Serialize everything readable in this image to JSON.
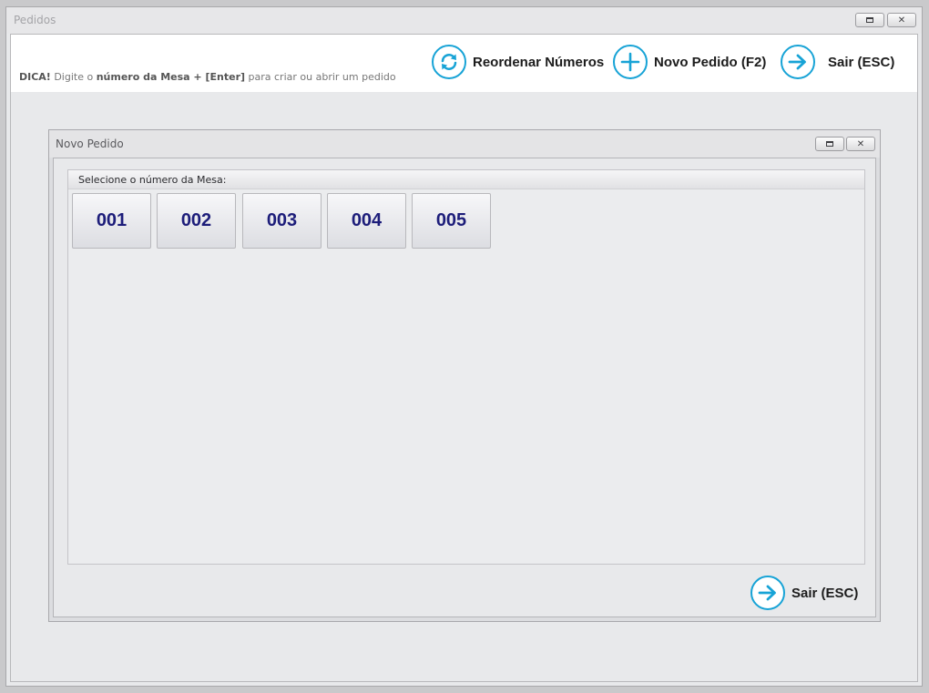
{
  "window": {
    "title": "Pedidos",
    "restore_glyph": "▫",
    "close_glyph": "✕"
  },
  "toolbar": {
    "hint_prefix": "DICA!",
    "hint_mid1": " Digite o ",
    "hint_bold1": "número da Mesa + [Enter]",
    "hint_suffix": " para criar ou abrir um pedido",
    "reorder_label": "Reordenar Números",
    "new_order_label": "Novo Pedido (F2)",
    "exit_label": "Sair (ESC)",
    "accent_color": "#17a3d6"
  },
  "dialog": {
    "title": "Novo Pedido",
    "group_label": "Selecione o número da Mesa:",
    "tables": [
      "001",
      "002",
      "003",
      "004",
      "005"
    ],
    "exit_label": "Sair (ESC)"
  },
  "icons": {
    "reorder": "refresh-icon",
    "new": "plus-icon",
    "exit": "arrow-right-icon"
  }
}
